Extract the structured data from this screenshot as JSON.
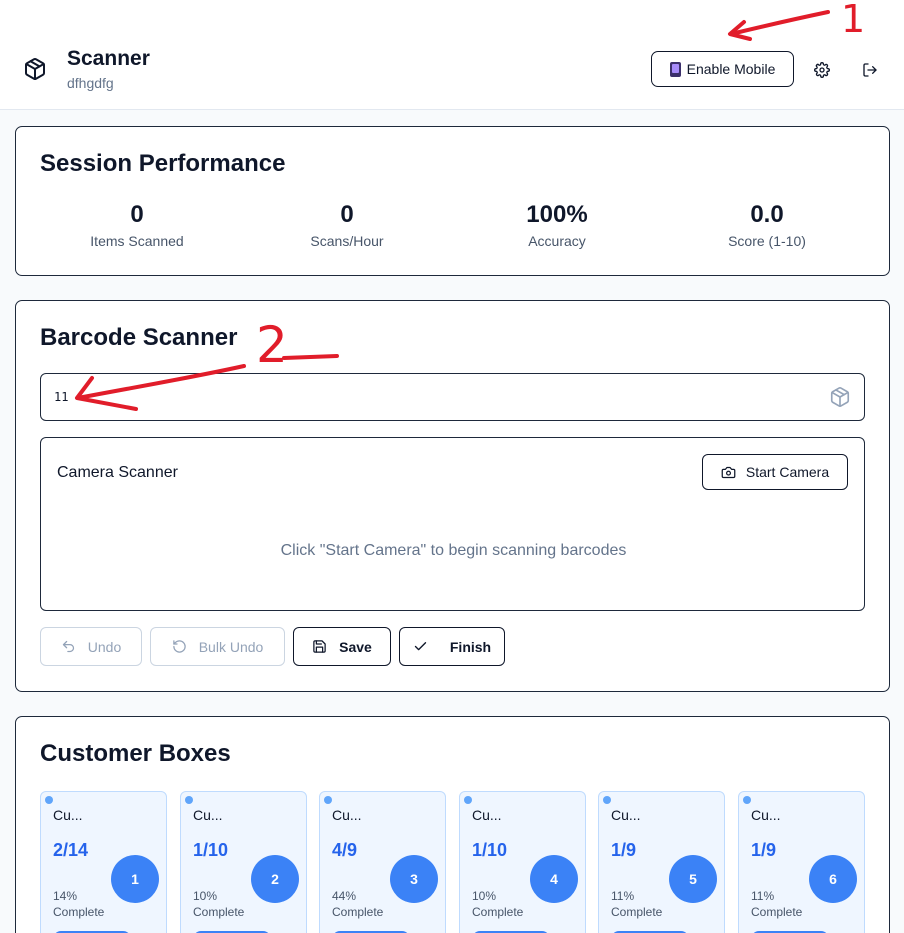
{
  "header": {
    "title": "Scanner",
    "subtitle": "dfhgdfg",
    "enable_mobile_label": "Enable Mobile",
    "logo_icon": "package-icon",
    "settings_icon": "gear-icon",
    "logout_icon": "logout-icon"
  },
  "annotations": {
    "mark_1": "1",
    "mark_2": "2",
    "color": "#e11d2a"
  },
  "performance": {
    "title": "Session Performance",
    "stats": [
      {
        "value": "0",
        "label": "Items Scanned"
      },
      {
        "value": "0",
        "label": "Scans/Hour"
      },
      {
        "value": "100%",
        "label": "Accuracy"
      },
      {
        "value": "0.0",
        "label": "Score (1-10)"
      }
    ]
  },
  "scanner": {
    "title": "Barcode Scanner",
    "input_value": "11",
    "input_icon": "package-icon",
    "camera_title": "Camera Scanner",
    "start_camera_label": "Start Camera",
    "camera_hint": "Click \"Start Camera\" to begin scanning barcodes",
    "actions": {
      "undo": "Undo",
      "bulk_undo": "Bulk Undo",
      "save": "Save",
      "finish": "Finish"
    }
  },
  "boxes": {
    "title": "Customer Boxes",
    "complete_label": "Complete",
    "items": [
      {
        "name": "Cu...",
        "count": "2/14",
        "number": "1",
        "percent": "14%",
        "progress": 0.14
      },
      {
        "name": "Cu...",
        "count": "1/10",
        "number": "2",
        "percent": "10%",
        "progress": 0.1
      },
      {
        "name": "Cu...",
        "count": "4/9",
        "number": "3",
        "percent": "44%",
        "progress": 0.44
      },
      {
        "name": "Cu...",
        "count": "1/10",
        "number": "4",
        "percent": "10%",
        "progress": 0.1
      },
      {
        "name": "Cu...",
        "count": "1/9",
        "number": "5",
        "percent": "11%",
        "progress": 0.11
      },
      {
        "name": "Cu...",
        "count": "1/9",
        "number": "6",
        "percent": "11%",
        "progress": 0.11
      }
    ]
  },
  "colors": {
    "accent": "#3b82f6",
    "accent_text": "#2563eb",
    "tile_bg": "#eff6ff",
    "border": "#1e293b"
  }
}
